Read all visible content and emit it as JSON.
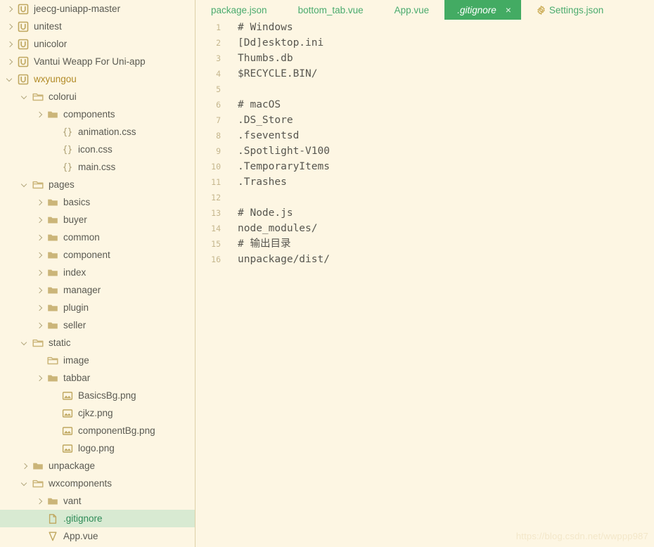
{
  "colors": {
    "background": "#fdf6e3",
    "accent_green": "#43ab63",
    "tab_text_green": "#4aab6e",
    "selected_row_bg": "#d8ead2",
    "folder_gold": "#cbb579",
    "project_active_text": "#b28b27",
    "line_number": "#c5b68d",
    "code_text": "#57564f",
    "divider": "#ddd0a8"
  },
  "sidebar": {
    "name": "project-explorer",
    "items": [
      {
        "label": "jeecg-uniapp-master",
        "depth": 0,
        "icon": "uniapp-project-icon",
        "chevron": "collapsed",
        "selected": false,
        "kind": "project"
      },
      {
        "label": "unitest",
        "depth": 0,
        "icon": "uniapp-project-icon",
        "chevron": "collapsed",
        "selected": false,
        "kind": "project"
      },
      {
        "label": "unicolor",
        "depth": 0,
        "icon": "uniapp-project-icon",
        "chevron": "collapsed",
        "selected": false,
        "kind": "project"
      },
      {
        "label": "Vantui Weapp For Uni-app",
        "depth": 0,
        "icon": "uniapp-project-icon",
        "chevron": "collapsed",
        "selected": false,
        "kind": "project"
      },
      {
        "label": "wxyungou",
        "depth": 0,
        "icon": "uniapp-project-icon",
        "chevron": "expanded",
        "selected": false,
        "kind": "project-active"
      },
      {
        "label": "colorui",
        "depth": 1,
        "icon": "folder-open-icon",
        "chevron": "expanded",
        "selected": false,
        "kind": "folder"
      },
      {
        "label": "components",
        "depth": 2,
        "icon": "folder-icon",
        "chevron": "collapsed",
        "selected": false,
        "kind": "folder"
      },
      {
        "label": "animation.css",
        "depth": 3,
        "icon": "css-file-icon",
        "chevron": "none",
        "selected": false,
        "kind": "file"
      },
      {
        "label": "icon.css",
        "depth": 3,
        "icon": "css-file-icon",
        "chevron": "none",
        "selected": false,
        "kind": "file"
      },
      {
        "label": "main.css",
        "depth": 3,
        "icon": "css-file-icon",
        "chevron": "none",
        "selected": false,
        "kind": "file"
      },
      {
        "label": "pages",
        "depth": 1,
        "icon": "folder-open-icon",
        "chevron": "expanded",
        "selected": false,
        "kind": "folder"
      },
      {
        "label": "basics",
        "depth": 2,
        "icon": "folder-icon",
        "chevron": "collapsed",
        "selected": false,
        "kind": "folder"
      },
      {
        "label": "buyer",
        "depth": 2,
        "icon": "folder-icon",
        "chevron": "collapsed",
        "selected": false,
        "kind": "folder"
      },
      {
        "label": "common",
        "depth": 2,
        "icon": "folder-icon",
        "chevron": "collapsed",
        "selected": false,
        "kind": "folder"
      },
      {
        "label": "component",
        "depth": 2,
        "icon": "folder-icon",
        "chevron": "collapsed",
        "selected": false,
        "kind": "folder"
      },
      {
        "label": "index",
        "depth": 2,
        "icon": "folder-icon",
        "chevron": "collapsed",
        "selected": false,
        "kind": "folder"
      },
      {
        "label": "manager",
        "depth": 2,
        "icon": "folder-icon",
        "chevron": "collapsed",
        "selected": false,
        "kind": "folder"
      },
      {
        "label": "plugin",
        "depth": 2,
        "icon": "folder-icon",
        "chevron": "collapsed",
        "selected": false,
        "kind": "folder"
      },
      {
        "label": "seller",
        "depth": 2,
        "icon": "folder-icon",
        "chevron": "collapsed",
        "selected": false,
        "kind": "folder"
      },
      {
        "label": "static",
        "depth": 1,
        "icon": "folder-open-icon",
        "chevron": "expanded",
        "selected": false,
        "kind": "folder"
      },
      {
        "label": "image",
        "depth": 2,
        "icon": "folder-open-icon",
        "chevron": "none",
        "selected": false,
        "kind": "folder"
      },
      {
        "label": "tabbar",
        "depth": 2,
        "icon": "folder-icon",
        "chevron": "collapsed",
        "selected": false,
        "kind": "folder"
      },
      {
        "label": "BasicsBg.png",
        "depth": 3,
        "icon": "image-file-icon",
        "chevron": "none",
        "selected": false,
        "kind": "file"
      },
      {
        "label": "cjkz.png",
        "depth": 3,
        "icon": "image-file-icon",
        "chevron": "none",
        "selected": false,
        "kind": "file"
      },
      {
        "label": "componentBg.png",
        "depth": 3,
        "icon": "image-file-icon",
        "chevron": "none",
        "selected": false,
        "kind": "file"
      },
      {
        "label": "logo.png",
        "depth": 3,
        "icon": "image-file-icon",
        "chevron": "none",
        "selected": false,
        "kind": "file"
      },
      {
        "label": "unpackage",
        "depth": 1,
        "icon": "folder-icon",
        "chevron": "collapsed",
        "selected": false,
        "kind": "folder"
      },
      {
        "label": "wxcomponents",
        "depth": 1,
        "icon": "folder-open-icon",
        "chevron": "expanded",
        "selected": false,
        "kind": "folder"
      },
      {
        "label": "vant",
        "depth": 2,
        "icon": "folder-icon",
        "chevron": "collapsed",
        "selected": false,
        "kind": "folder"
      },
      {
        "label": ".gitignore",
        "depth": 2,
        "icon": "plain-file-icon",
        "chevron": "none",
        "selected": true,
        "kind": "file"
      },
      {
        "label": "App.vue",
        "depth": 2,
        "icon": "vue-file-icon",
        "chevron": "none",
        "selected": false,
        "kind": "file"
      }
    ]
  },
  "tabbar": {
    "name": "editor-tabbar",
    "tabs": [
      {
        "label": "package.json",
        "active": false,
        "closable": false,
        "icon": "none"
      },
      {
        "label": "bottom_tab.vue",
        "active": false,
        "closable": false,
        "icon": "none"
      },
      {
        "label": "App.vue",
        "active": false,
        "closable": false,
        "icon": "none"
      },
      {
        "label": ".gitignore",
        "active": true,
        "closable": true,
        "icon": "none",
        "close_label": "×"
      },
      {
        "label": "Settings.json",
        "active": false,
        "closable": false,
        "icon": "gear-icon"
      }
    ]
  },
  "editor": {
    "name": "code-editor",
    "filename": ".gitignore",
    "lines": [
      {
        "n": 1,
        "text": "# Windows"
      },
      {
        "n": 2,
        "text": "[Dd]esktop.ini"
      },
      {
        "n": 3,
        "text": "Thumbs.db"
      },
      {
        "n": 4,
        "text": "$RECYCLE.BIN/"
      },
      {
        "n": 5,
        "text": ""
      },
      {
        "n": 6,
        "text": "# macOS"
      },
      {
        "n": 7,
        "text": ".DS_Store"
      },
      {
        "n": 8,
        "text": ".fseventsd"
      },
      {
        "n": 9,
        "text": ".Spotlight-V100"
      },
      {
        "n": 10,
        "text": ".TemporaryItems"
      },
      {
        "n": 11,
        "text": ".Trashes"
      },
      {
        "n": 12,
        "text": ""
      },
      {
        "n": 13,
        "text": "# Node.js"
      },
      {
        "n": 14,
        "text": "node_modules/"
      },
      {
        "n": 15,
        "text": "# 输出目录"
      },
      {
        "n": 16,
        "text": "unpackage/dist/"
      }
    ]
  },
  "watermark": {
    "text": "https://blog.csdn.net/wwppp987"
  }
}
